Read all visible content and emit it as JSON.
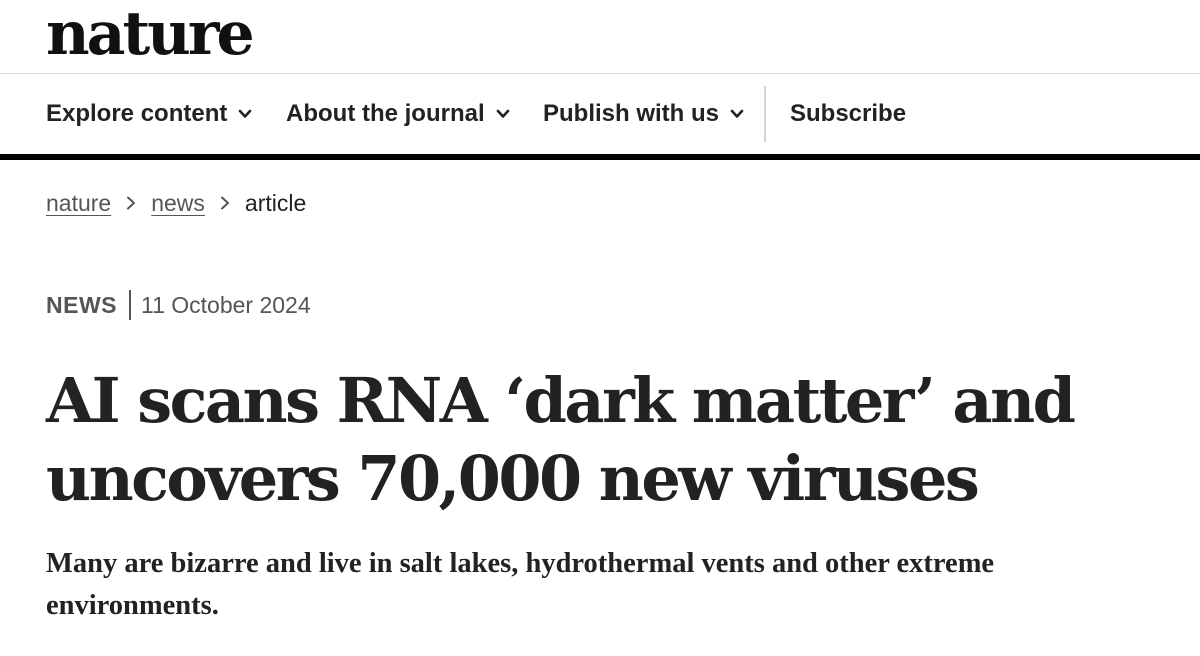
{
  "site": {
    "logo": "nature"
  },
  "nav": {
    "items": [
      {
        "label": "Explore content",
        "has_dropdown": true
      },
      {
        "label": "About the journal",
        "has_dropdown": true
      },
      {
        "label": "Publish with us",
        "has_dropdown": true
      }
    ],
    "subscribe_label": "Subscribe"
  },
  "breadcrumb": {
    "items": [
      "nature",
      "news",
      "article"
    ]
  },
  "article": {
    "type": "NEWS",
    "date": "11 October 2024",
    "title_line1": "AI scans RNA ‘dark matter’ and",
    "title_line2": "uncovers 70,000 new viruses",
    "standfirst": "Many are bizarre and live in salt lakes, hydrothermal vents and other extreme environments."
  },
  "icons": {
    "dropdown": "chevron-down-icon",
    "breadcrumb_separator": "chevron-right-icon"
  },
  "colors": {
    "text": "#222222",
    "muted": "#555555",
    "rule": "#000000",
    "divider": "#dcdcdc"
  }
}
